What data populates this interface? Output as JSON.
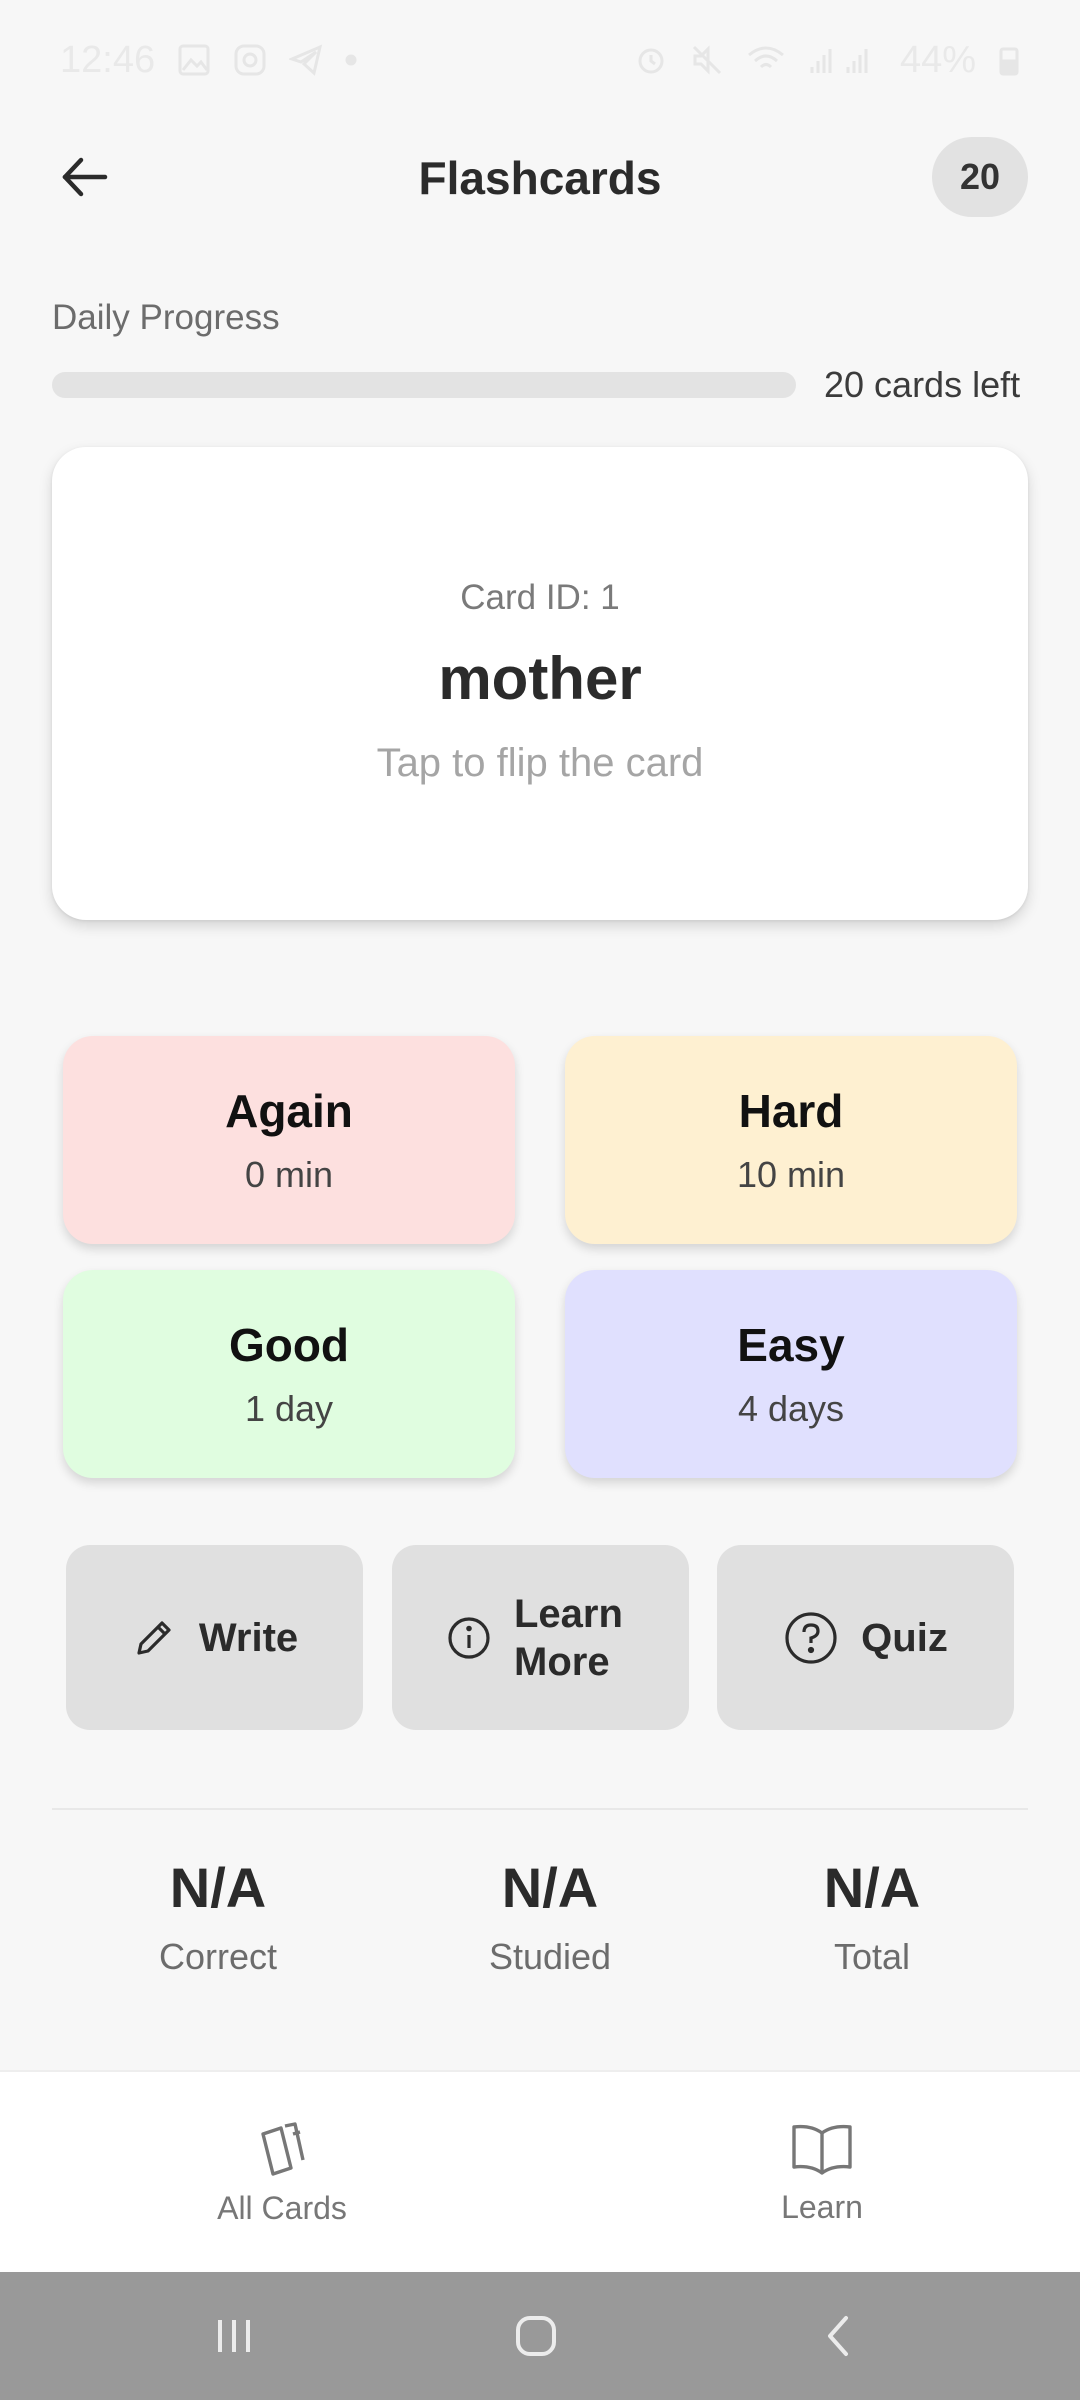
{
  "status_bar": {
    "time": "12:46",
    "battery": "44%"
  },
  "header": {
    "title": "Flashcards",
    "count_badge": "20"
  },
  "progress": {
    "label": "Daily Progress",
    "cards_left_text": "20 cards left",
    "fraction_complete": 0
  },
  "card": {
    "id_text": "Card ID: 1",
    "word": "mother",
    "hint": "Tap to flip the card"
  },
  "ratings": [
    {
      "name": "Again",
      "time": "0 min",
      "color": "#fde0df"
    },
    {
      "name": "Hard",
      "time": "10 min",
      "color": "#fef0d1"
    },
    {
      "name": "Good",
      "time": "1 day",
      "color": "#e0fde0"
    },
    {
      "name": "Easy",
      "time": "4 days",
      "color": "#e0e0fe"
    }
  ],
  "actions": {
    "write": "Write",
    "learn_more": "Learn More",
    "quiz": "Quiz"
  },
  "stats": {
    "correct": {
      "value": "N/A",
      "label": "Correct"
    },
    "studied": {
      "value": "N/A",
      "label": "Studied"
    },
    "total": {
      "value": "N/A",
      "label": "Total"
    }
  },
  "bottom_nav": {
    "all_cards": "All Cards",
    "learn": "Learn"
  },
  "icons": {
    "back": "arrow-left-icon",
    "write": "pencil-icon",
    "learn_more": "info-icon",
    "quiz": "question-icon",
    "all_cards": "cards-icon",
    "learn": "book-icon"
  }
}
